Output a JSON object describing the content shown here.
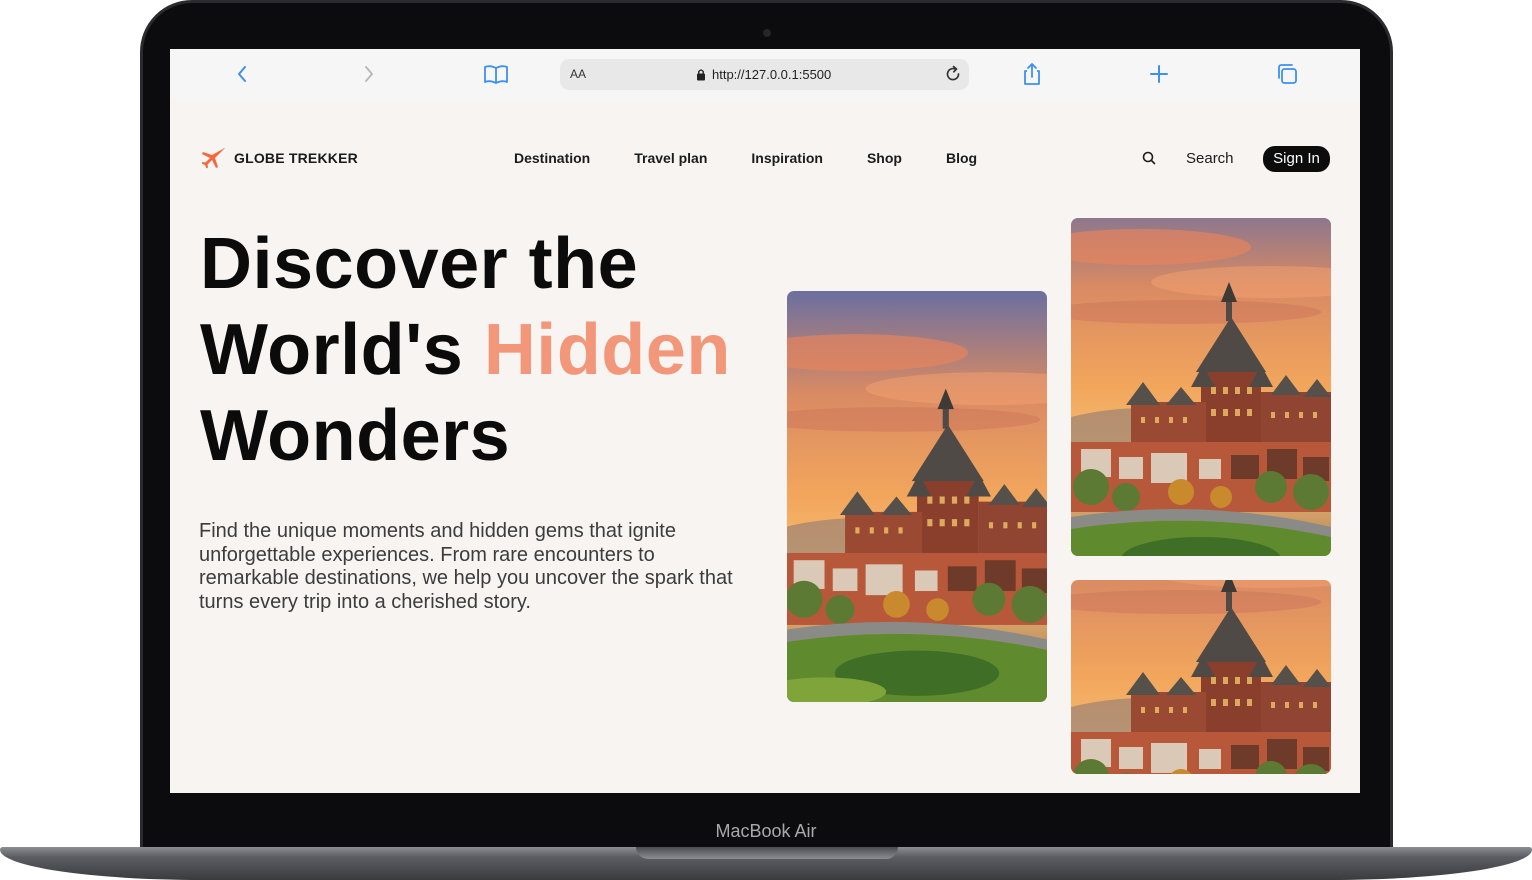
{
  "device": {
    "label": "MacBook Air"
  },
  "browser": {
    "aa_label": "AA",
    "url": "http://127.0.0.1:5500",
    "icons": [
      "back-icon",
      "forward-icon",
      "bookmarks-icon",
      "lock-icon",
      "reload-icon",
      "share-icon",
      "new-tab-icon",
      "tabs-icon"
    ]
  },
  "site": {
    "brand": "GLOBE TREKKER",
    "brand_icon": "airplane-icon",
    "brand_color": "#f4683c",
    "nav": [
      {
        "label": "Destination"
      },
      {
        "label": "Travel plan"
      },
      {
        "label": "Inspiration"
      },
      {
        "label": "Shop"
      },
      {
        "label": "Blog"
      }
    ],
    "search_label": "Search",
    "signin_label": "Sign In"
  },
  "hero": {
    "title_line1": "Discover the",
    "title_line2_prefix": "World's ",
    "title_line2_accent": "Hidden",
    "title_line3": "Wonders",
    "accent_color": "#f2977a",
    "description": "Find the unique moments and hidden gems that ignite unforgettable experiences. From rare encounters to remarkable destinations, we help you uncover the spark that turns every trip into a cherished story."
  },
  "gallery": {
    "images": [
      {
        "subject": "Chateau Frontenac city view at sunset"
      },
      {
        "subject": "Chateau Frontenac city view at sunset"
      },
      {
        "subject": "Chateau Frontenac city view at sunset"
      }
    ]
  }
}
